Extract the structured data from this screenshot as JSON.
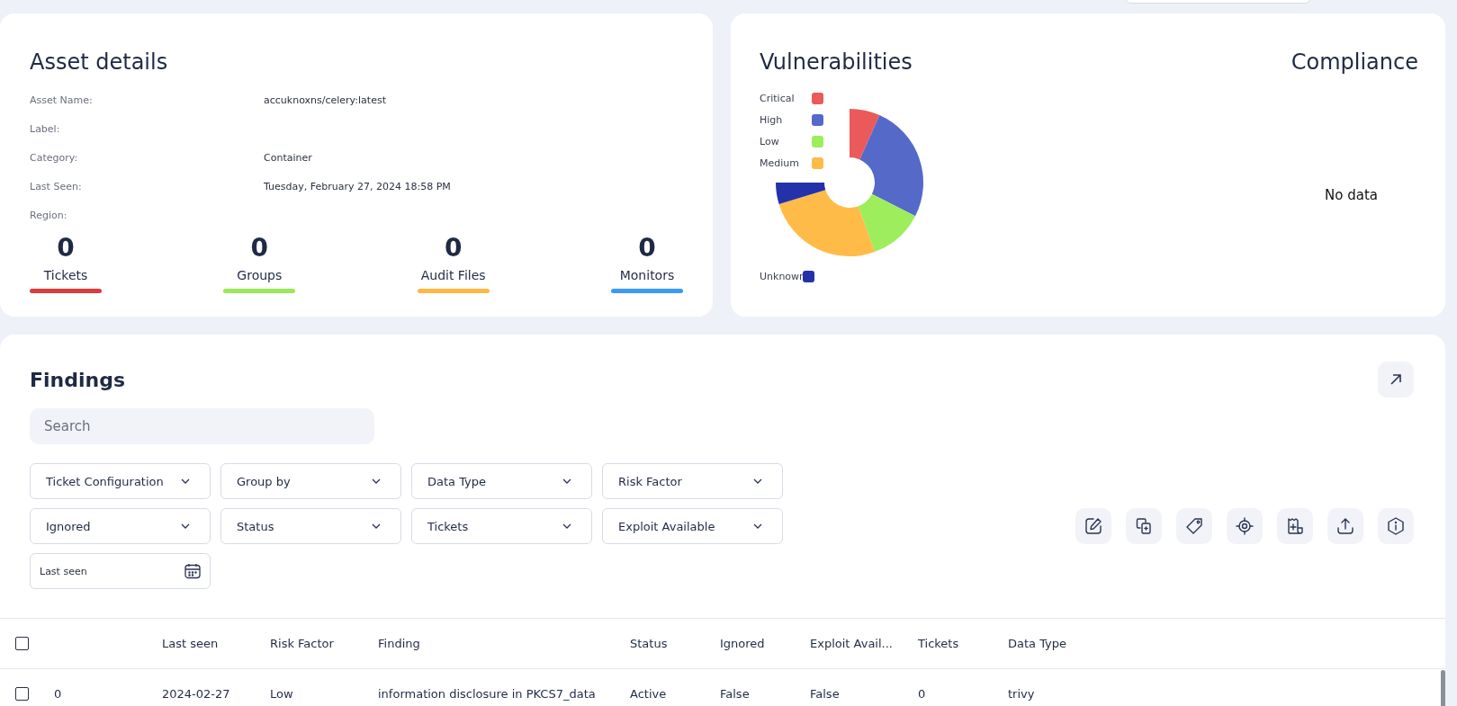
{
  "asset_details": {
    "title": "Asset details",
    "fields": [
      {
        "label": "Asset Name:",
        "value": "accuknoxns/celery:latest"
      },
      {
        "label": "Label:"
      },
      {
        "label": "Category:",
        "value": "Container"
      },
      {
        "label": "Last Seen:",
        "value": "Tuesday, February 27, 2024 18:58 PM"
      },
      {
        "label": "Region:"
      }
    ],
    "stats": [
      {
        "count": "0",
        "label": "Tickets",
        "color": "#dd3c3c"
      },
      {
        "count": "0",
        "label": "Groups",
        "color": "#9be85a"
      },
      {
        "count": "0",
        "label": "Audit Files",
        "color": "#ffb845"
      },
      {
        "count": "0",
        "label": "Monitors",
        "color": "#3a9bf5"
      }
    ]
  },
  "vulnerabilities": {
    "title": "Vulnerabilities",
    "legend": [
      {
        "label": "Critical",
        "color": "#eb5a5a"
      },
      {
        "label": "High",
        "color": "#5569c9"
      },
      {
        "label": "Low",
        "color": "#9ded5c"
      },
      {
        "label": "Medium",
        "color": "#ffbb48"
      },
      {
        "label": "Unknown",
        "color": "#2431ab"
      }
    ]
  },
  "compliance": {
    "title": "Compliance",
    "empty_text": "No data"
  },
  "findings": {
    "title": "Findings",
    "search": {
      "placeholder": "Search"
    },
    "filters": [
      {
        "label": "Ticket Configuration"
      },
      {
        "label": "Group by"
      },
      {
        "label": "Data Type"
      },
      {
        "label": "Risk Factor"
      },
      {
        "label": "Ignored"
      },
      {
        "label": "Status"
      },
      {
        "label": "Tickets"
      },
      {
        "label": "Exploit Available"
      }
    ],
    "date_field": {
      "placeholder": "Last seen"
    },
    "actions": [
      {
        "kind": "edit"
      },
      {
        "kind": "copy"
      },
      {
        "kind": "tag"
      },
      {
        "kind": "target"
      },
      {
        "kind": "receipt"
      },
      {
        "kind": "upload"
      },
      {
        "kind": "info"
      }
    ],
    "table": {
      "select_all_checked": false,
      "columns": [
        "",
        "Last seen",
        "Risk Factor",
        "Finding",
        "Status",
        "Ignored",
        "Exploit Avail...",
        "Tickets",
        "Data Type"
      ],
      "rows": [
        {
          "checked": false,
          "cells": [
            "0",
            "2024-02-27",
            "Low",
            "information disclosure in PKCS7_data",
            "Active",
            "False",
            "False",
            "0",
            "trivy"
          ]
        }
      ]
    }
  }
}
